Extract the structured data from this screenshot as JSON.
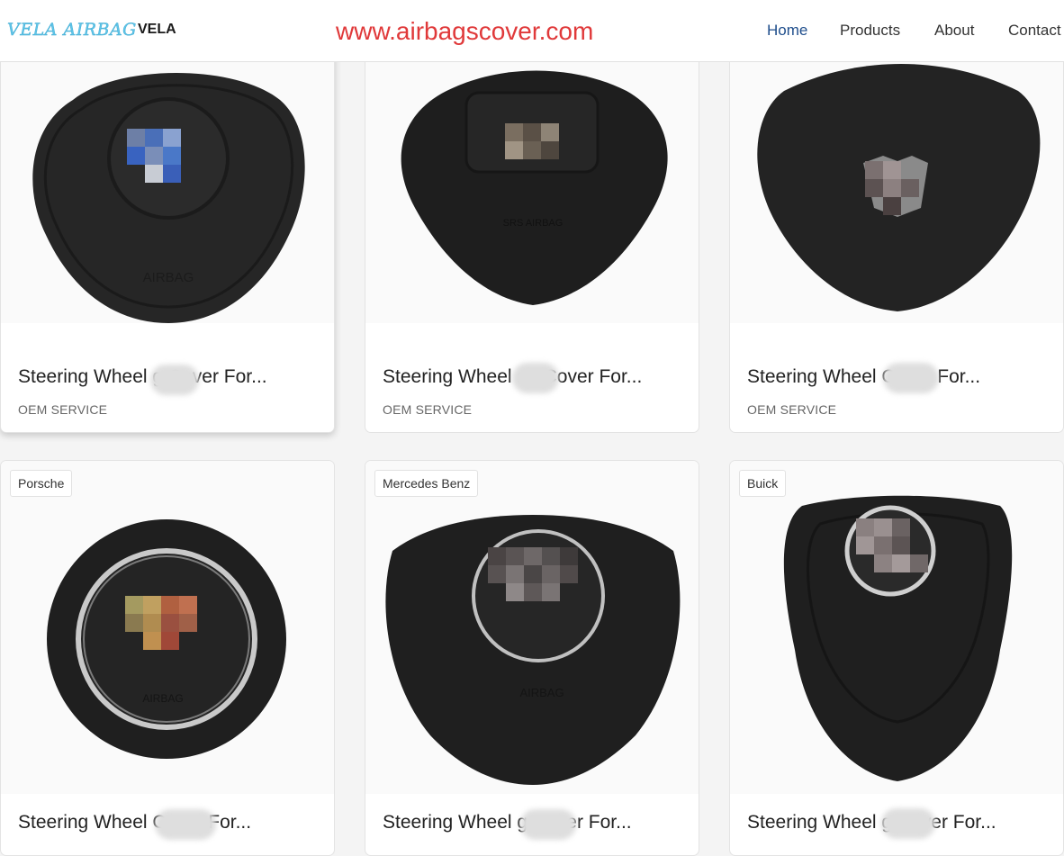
{
  "header": {
    "logo_text": "VELA AIRBAG",
    "brand": "VELA",
    "site_url": "www.airbagscover.com",
    "nav": [
      "Home",
      "Products",
      "About",
      "Contact"
    ],
    "active_nav": "Home"
  },
  "products": [
    {
      "title": "Steering Wheel g Cover For...",
      "subtitle": "OEM SERVICE",
      "badge": "",
      "emboss": "AIRBAG",
      "image_icon": "airbag-cover-image"
    },
    {
      "title": "Steering Wheel ag Cover For...",
      "subtitle": "OEM SERVICE",
      "badge": "",
      "emboss": "SRS AIRBAG",
      "image_icon": "airbag-cover-image"
    },
    {
      "title": "Steering Wheel Cover For...",
      "subtitle": "OEM SERVICE",
      "badge": "",
      "emboss": "",
      "image_icon": "airbag-cover-image"
    },
    {
      "title": "Steering Wheel Cover For...",
      "subtitle": "",
      "badge": "Porsche",
      "emboss": "AIRBAG",
      "image_icon": "airbag-cover-image"
    },
    {
      "title": "Steering Wheel g Cover For...",
      "subtitle": "",
      "badge": "Mercedes Benz",
      "emboss": "AIRBAG",
      "image_icon": "airbag-cover-image"
    },
    {
      "title": "Steering Wheel g Cover For...",
      "subtitle": "",
      "badge": "Buick",
      "emboss": "",
      "image_icon": "airbag-cover-image"
    }
  ],
  "colors": {
    "accent": "#e0393a",
    "nav_active": "#1f4e8c",
    "logo": "#5fc4e8"
  }
}
